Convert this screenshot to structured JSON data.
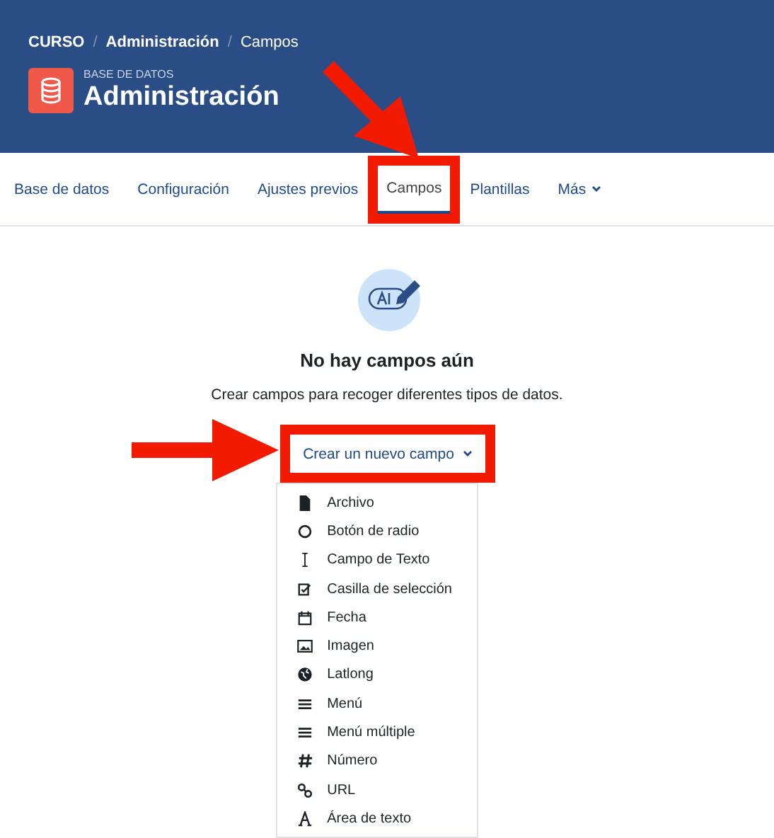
{
  "breadcrumb_separator": "/",
  "breadcrumb": [
    {
      "label": "CURSO",
      "bold": true
    },
    {
      "label": "Administración",
      "bold": true
    },
    {
      "label": "Campos",
      "bold": false
    }
  ],
  "header": {
    "subtitle": "BASE DE DATOS",
    "title": "Administración"
  },
  "tabs": [
    {
      "label": "Base de datos",
      "selected": false,
      "highlighted": false,
      "dropdown": false
    },
    {
      "label": "Configuración",
      "selected": false,
      "highlighted": false,
      "dropdown": false
    },
    {
      "label": "Ajustes previos",
      "selected": false,
      "highlighted": false,
      "dropdown": false
    },
    {
      "label": "Campos",
      "selected": true,
      "highlighted": true,
      "dropdown": false
    },
    {
      "label": "Plantillas",
      "selected": false,
      "highlighted": false,
      "dropdown": false
    },
    {
      "label": "Más",
      "selected": false,
      "highlighted": false,
      "dropdown": true
    }
  ],
  "empty_state": {
    "heading": "No hay campos aún",
    "text": "Crear campos para recoger diferentes tipos de datos."
  },
  "create_button": {
    "label": "Crear un nuevo campo",
    "highlighted": true,
    "expanded": true
  },
  "menu": {
    "items": [
      {
        "label": "Archivo"
      },
      {
        "label": "Botón de radio"
      },
      {
        "label": "Campo de Texto"
      },
      {
        "label": "Casilla de selección"
      },
      {
        "label": "Fecha"
      },
      {
        "label": "Imagen"
      },
      {
        "label": "Latlong"
      },
      {
        "label": "Menú"
      },
      {
        "label": "Menú múltiple"
      },
      {
        "label": "Número"
      },
      {
        "label": "URL"
      },
      {
        "label": "Área de texto"
      }
    ]
  }
}
